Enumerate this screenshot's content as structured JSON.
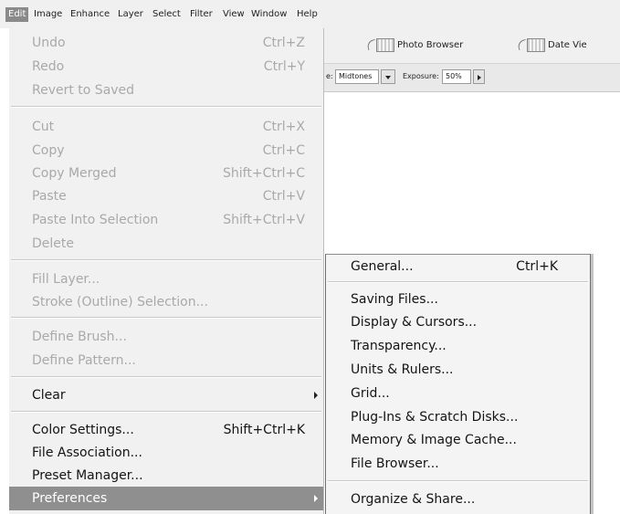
{
  "menubar": {
    "items": [
      "Edit",
      "Image",
      "Enhance",
      "Layer",
      "Select",
      "Filter",
      "View",
      "Window",
      "Help"
    ]
  },
  "toolbar": {
    "photo_browser": "Photo Browser",
    "date_view": "Date Vie"
  },
  "options_bar": {
    "range_label": "e:",
    "range_value": "Midtones",
    "exposure_label": "Exposure:",
    "exposure_value": "50%"
  },
  "edit_menu": {
    "undo": {
      "label": "Undo",
      "shortcut": "Ctrl+Z"
    },
    "redo": {
      "label": "Redo",
      "shortcut": "Ctrl+Y"
    },
    "revert": {
      "label": "Revert to Saved"
    },
    "cut": {
      "label": "Cut",
      "shortcut": "Ctrl+X"
    },
    "copy": {
      "label": "Copy",
      "shortcut": "Ctrl+C"
    },
    "copy_merged": {
      "label": "Copy Merged",
      "shortcut": "Shift+Ctrl+C"
    },
    "paste": {
      "label": "Paste",
      "shortcut": "Ctrl+V"
    },
    "paste_into": {
      "label": "Paste Into Selection",
      "shortcut": "Shift+Ctrl+V"
    },
    "delete": {
      "label": "Delete"
    },
    "fill_layer": {
      "label": "Fill Layer..."
    },
    "stroke": {
      "label": "Stroke (Outline) Selection..."
    },
    "define_brush": {
      "label": "Define Brush..."
    },
    "define_pattern": {
      "label": "Define Pattern..."
    },
    "clear": {
      "label": "Clear"
    },
    "color_settings": {
      "label": "Color Settings...",
      "shortcut": "Shift+Ctrl+K"
    },
    "file_association": {
      "label": "File Association..."
    },
    "preset_manager": {
      "label": "Preset Manager..."
    },
    "preferences": {
      "label": "Preferences"
    }
  },
  "preferences_menu": {
    "general": {
      "label": "General...",
      "shortcut": "Ctrl+K"
    },
    "saving_files": "Saving Files...",
    "display_cursors": "Display & Cursors...",
    "transparency": "Transparency...",
    "units_rulers": "Units & Rulers...",
    "grid": "Grid...",
    "plugins": "Plug-Ins & Scratch Disks...",
    "memory": "Memory & Image Cache...",
    "file_browser": "File Browser...",
    "organize_share": "Organize & Share..."
  }
}
